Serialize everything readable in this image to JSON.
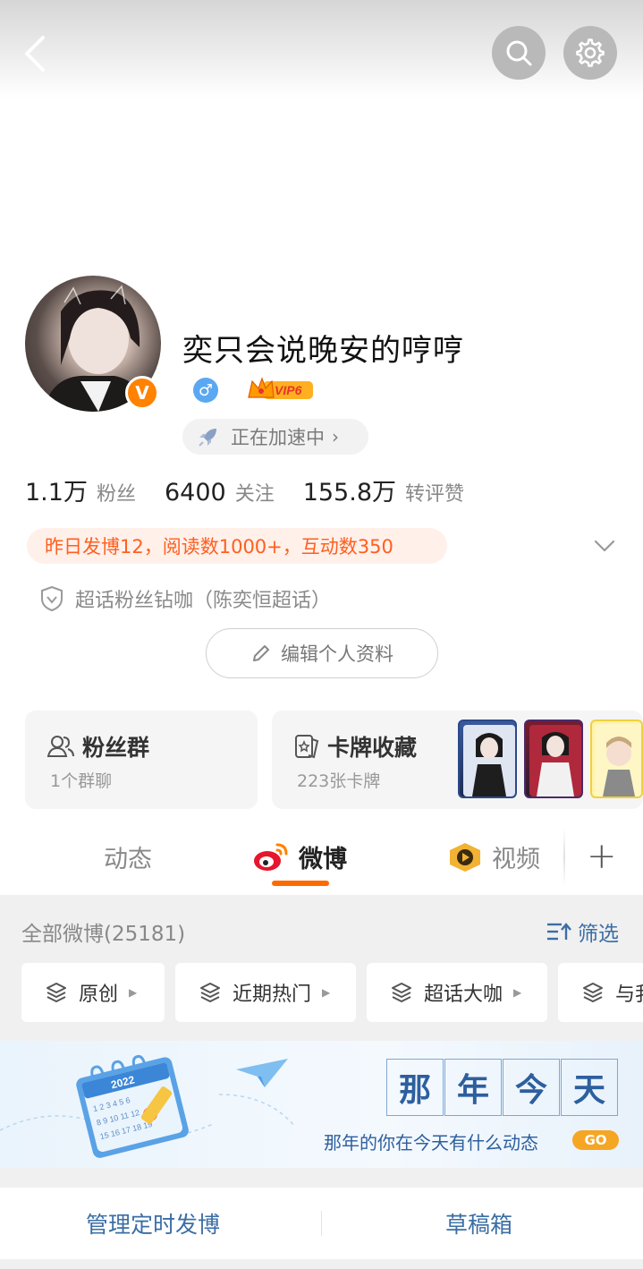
{
  "header": {
    "back_icon": "chevron-left-icon",
    "search_icon": "search-icon",
    "settings_icon": "gear-icon"
  },
  "profile": {
    "username": "奕只会说晚安的哼哼",
    "verified_badge": "V",
    "gender_symbol": "♂",
    "vip_label": "VIP6",
    "accelerate_label": "正在加速中",
    "accelerate_arrow": "›",
    "stats": [
      {
        "value": "1.1万",
        "label": "粉丝"
      },
      {
        "value": "6400",
        "label": "关注"
      },
      {
        "value": "155.8万",
        "label": "转评赞"
      }
    ],
    "highlight": "昨日发博12，阅读数1000+，互动数350",
    "fan_badge": "超话粉丝钻咖（陈奕恒超话）",
    "edit_label": "编辑个人资料"
  },
  "cards": {
    "fans_group": {
      "title": "粉丝群",
      "sub": "1个群聊"
    },
    "card_collection": {
      "title": "卡牌收藏",
      "sub": "223张卡牌"
    }
  },
  "tabs": [
    {
      "label": "动态"
    },
    {
      "label": "微博"
    },
    {
      "label": "视频"
    }
  ],
  "tab_add": "+",
  "feed": {
    "all_label": "全部微博(25181)",
    "filter_label": "筛选",
    "chips": [
      "原创",
      "近期热门",
      "超话大咖",
      "与我"
    ]
  },
  "banner": {
    "chars": [
      "那",
      "年",
      "今",
      "天"
    ],
    "subtitle": "那年的你在今天有什么动态",
    "go_label": "GO",
    "calendar_year": "2022"
  },
  "bottom": {
    "scheduled": "管理定时发博",
    "drafts": "草稿箱"
  },
  "colors": {
    "accent_orange": "#ff8200",
    "highlight_text": "#ff5f1f",
    "link_blue": "#3b6ea5",
    "tab_active_underline": "#ff6a00"
  }
}
